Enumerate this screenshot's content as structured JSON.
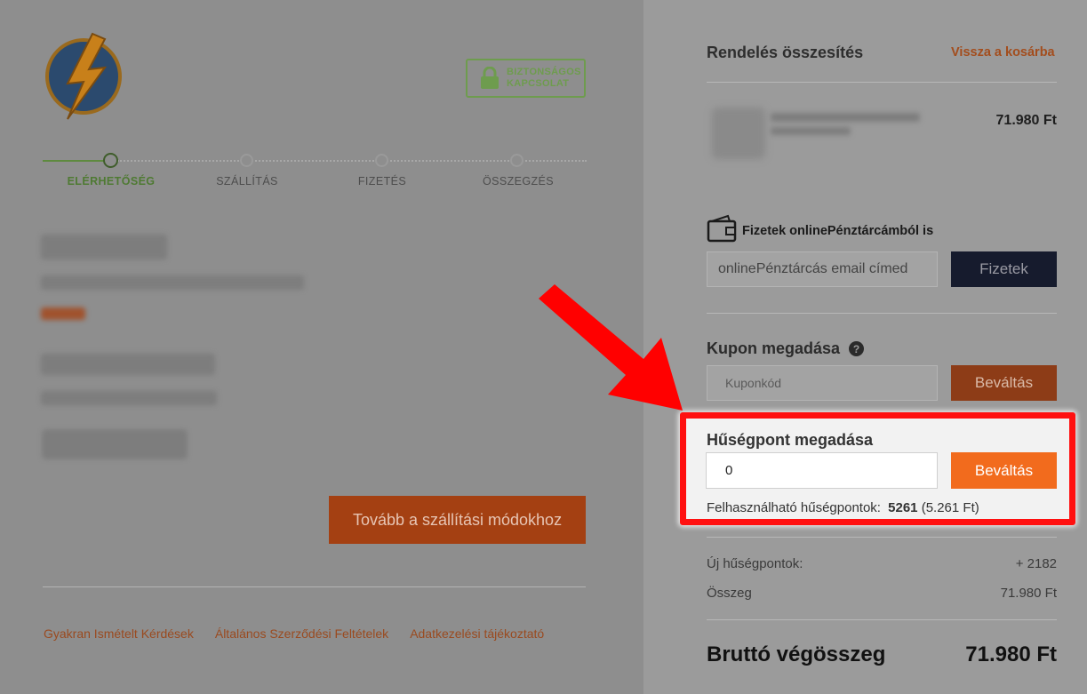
{
  "header": {
    "secure_badge": "BIZTONSÁGOS KAPCSOLAT"
  },
  "stepper": {
    "steps": [
      "ELÉRHETŐSÉG",
      "SZÁLLÍTÁS",
      "FIZETÉS",
      "ÖSSZEGZÉS"
    ],
    "active_index": 0
  },
  "checkout": {
    "next_button": "Tovább a szállítási módokhoz"
  },
  "footer": {
    "links": [
      "Gyakran Ismételt Kérdések",
      "Általános Szerződési Feltételek",
      "Adatkezelési tájékoztató"
    ]
  },
  "summary": {
    "title": "Rendelés összesítés",
    "back_link": "Vissza a kosárba",
    "product_price": "71.980 Ft"
  },
  "wallet": {
    "label": "Fizetek onlinePénztárcámból is",
    "placeholder": "onlinePénztárcás email címed",
    "pay_button": "Fizetek"
  },
  "coupon": {
    "title": "Kupon megadása",
    "placeholder": "Kuponkód",
    "redeem_button": "Beváltás"
  },
  "loyalty": {
    "title": "Hűségpont megadása",
    "value": "0",
    "redeem_button": "Beváltás",
    "available_label": "Felhasználható hűségpontok:",
    "available_points": "5261",
    "available_amount": "(5.261 Ft)"
  },
  "totals": {
    "new_points_label": "Új hűségpontok:",
    "new_points_value": "+ 2182",
    "sum_label": "Összeg",
    "sum_value": "71.980 Ft",
    "gross_label": "Bruttó végösszeg",
    "gross_value": "71.980 Ft"
  },
  "colors": {
    "accent_orange": "#f26b1d",
    "highlight_red": "#ff1010",
    "success_green": "#6e9c4e",
    "navy": "#161b2d"
  }
}
